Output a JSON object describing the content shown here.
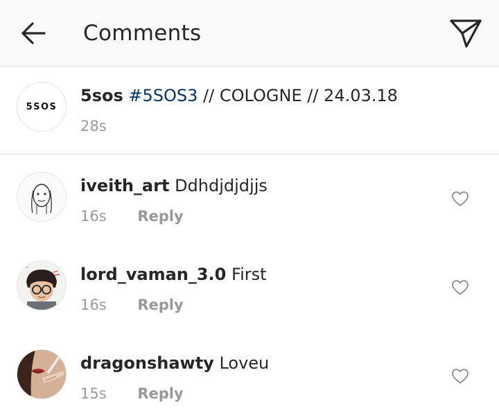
{
  "header": {
    "title": "Comments"
  },
  "caption": {
    "avatar_text": "5SOS",
    "username": "5sos",
    "hashtag": "#5SOS3",
    "text": " // COLOGNE // 24.03.18",
    "time": "28s"
  },
  "comments": [
    {
      "username": "iveith_art",
      "text": " Ddhdjdjdjjs",
      "time": "16s",
      "reply_label": "Reply"
    },
    {
      "username": "lord_vaman_3.0",
      "text": " First",
      "time": "16s",
      "reply_label": "Reply"
    },
    {
      "username": "dragonshawty",
      "text": " Loveu",
      "time": "15s",
      "reply_label": "Reply"
    }
  ],
  "icons": {
    "back": "back-arrow-icon",
    "send": "paper-plane-icon",
    "like": "heart-outline-icon"
  },
  "colors": {
    "header_bg": "#fafafa",
    "text_primary": "#262626",
    "text_secondary": "#999999",
    "hashtag": "#003569",
    "divider": "#dbdbdb"
  }
}
